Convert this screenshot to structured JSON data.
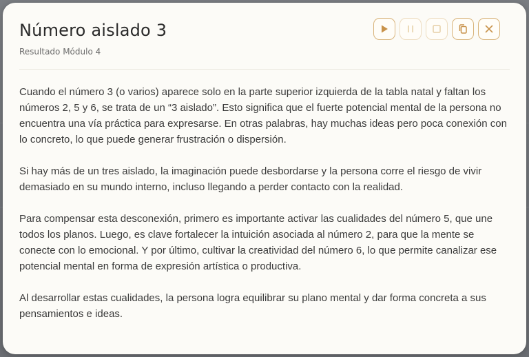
{
  "modal": {
    "title": "Número aislado 3",
    "subtitle": "Resultado Módulo 4",
    "controls": [
      {
        "name": "play-button",
        "icon": "play-icon",
        "enabled": true
      },
      {
        "name": "pause-button",
        "icon": "pause-icon",
        "enabled": false
      },
      {
        "name": "stop-button",
        "icon": "stop-icon",
        "enabled": false
      },
      {
        "name": "copy-button",
        "icon": "copy-icon",
        "enabled": true
      },
      {
        "name": "close-button",
        "icon": "close-icon",
        "enabled": true
      }
    ],
    "paragraphs": [
      "Cuando el número 3 (o varios) aparece solo en la parte superior izquierda de la tabla natal y faltan los números 2, 5 y 6, se trata de un “3 aislado”. Esto significa que el fuerte potencial mental de la persona no encuentra una vía práctica para expresarse. En otras palabras, hay muchas ideas pero poca conexión con lo concreto, lo que puede generar frustración o dispersión.",
      "Si hay más de un tres aislado, la imaginación puede desbordarse y la persona corre el riesgo de vivir demasiado en su mundo interno, incluso llegando a perder contacto con la realidad.",
      "Para compensar esta desconexión, primero es importante activar las cualidades del número 5, que une todos los planos. Luego, es clave fortalecer la intuición asociada al número 2, para que la mente se conecte con lo emocional. Y por último, cultivar la creatividad del número 6, lo que permite canalizar ese potencial mental en forma de expresión artística o productiva.",
      "Al desarrollar estas cualidades, la persona logra equilibrar su plano mental y dar forma concreta a sus pensamientos e ideas."
    ]
  },
  "colors": {
    "accent": "#c8924a",
    "accent_border": "#d8b37a",
    "disabled": "#eddcbf",
    "modal_bg": "#fcfbf7",
    "text": "#3a3a3a"
  }
}
